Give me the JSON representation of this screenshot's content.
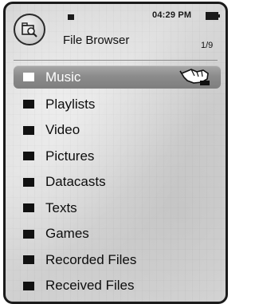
{
  "status_bar": {
    "time": "04:29 PM",
    "battery_icon": "battery-icon",
    "signal_icon": "signal-icon"
  },
  "header": {
    "app_icon": "file-browser-icon",
    "title": "File Browser",
    "page_count": "1/9"
  },
  "list": {
    "selected_index": 0,
    "items": [
      {
        "label": "Music",
        "icon": "folder-icon"
      },
      {
        "label": "Playlists",
        "icon": "folder-icon"
      },
      {
        "label": "Video",
        "icon": "folder-icon"
      },
      {
        "label": "Pictures",
        "icon": "folder-icon"
      },
      {
        "label": "Datacasts",
        "icon": "folder-icon"
      },
      {
        "label": "Texts",
        "icon": "folder-icon"
      },
      {
        "label": "Games",
        "icon": "folder-icon"
      },
      {
        "label": "Recorded Files",
        "icon": "folder-icon"
      },
      {
        "label": "Received Files",
        "icon": "folder-icon"
      }
    ]
  },
  "colors": {
    "selection": "#8c8c8c",
    "text": "#0d0d0d",
    "selected_text": "#ffffff"
  }
}
